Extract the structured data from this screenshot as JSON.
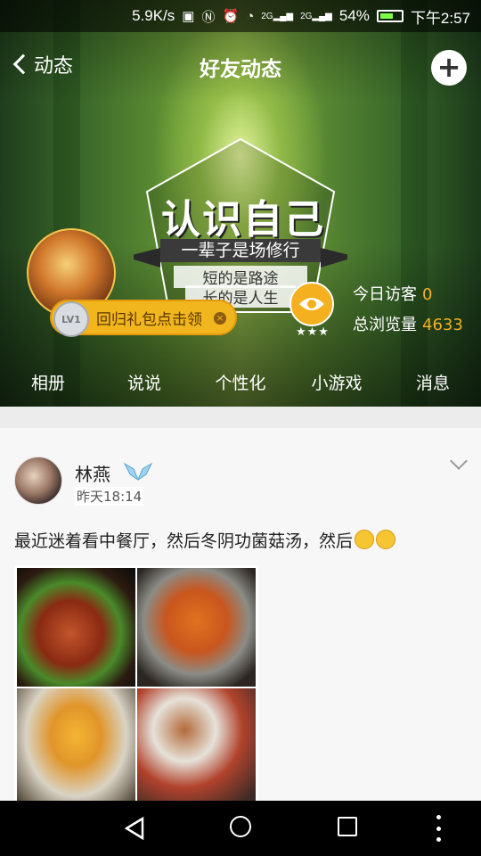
{
  "status_bar": {
    "speed": "5.9K/s",
    "signal_1": "2G",
    "signal_2": "2G",
    "battery": "54%",
    "time": "下午2:57"
  },
  "header": {
    "back_label": "动态",
    "title": "好友动态"
  },
  "cover": {
    "emblem_title": "认识自己",
    "emblem_ribbon": "一辈子是场修行",
    "emblem_line1": "短的是路途",
    "emblem_line2": "长的是人生",
    "level": "LV1",
    "badge_text": "回归礼包点击领",
    "today_visitors_label": "今日访客",
    "today_visitors": "0",
    "total_views_label": "总浏览量",
    "total_views": "4633",
    "stars": "★★★"
  },
  "tabs": [
    {
      "label": "相册"
    },
    {
      "label": "说说"
    },
    {
      "label": "个性化"
    },
    {
      "label": "小游戏"
    },
    {
      "label": "消息"
    }
  ],
  "post": {
    "author": "林燕",
    "time": "昨天18:14",
    "text": "最近迷着看中餐厅，然后冬阴功菌菇汤，然后"
  },
  "colors": {
    "accent": "#f4b01e",
    "badge": "#f1b51e"
  }
}
